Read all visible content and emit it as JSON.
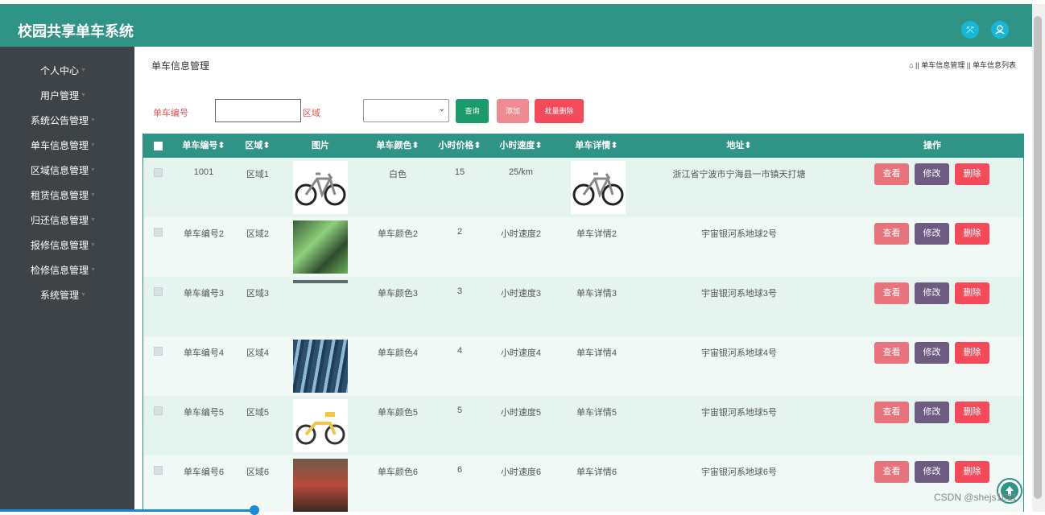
{
  "app": {
    "title": "校园共享单车系统"
  },
  "header": {
    "icons": [
      "expand-icon",
      "user-icon"
    ]
  },
  "sidebar": {
    "items": [
      {
        "label": "个人中心"
      },
      {
        "label": "用户管理"
      },
      {
        "label": "系统公告管理"
      },
      {
        "label": "单车信息管理"
      },
      {
        "label": "区域信息管理"
      },
      {
        "label": "租赁信息管理"
      },
      {
        "label": "归还信息管理"
      },
      {
        "label": "报修信息管理"
      },
      {
        "label": "检修信息管理"
      },
      {
        "label": "系统管理"
      }
    ]
  },
  "main": {
    "title": "单车信息管理",
    "breadcrumb": {
      "sep": "||",
      "item1": "单车信息管理",
      "item2": "单车信息列表"
    }
  },
  "search": {
    "bike_no_label": "单车编号",
    "bike_no_value": "",
    "region_label": "区域",
    "region_value": "",
    "query_btn": "查询",
    "add_btn": "添加",
    "batch_delete_btn": "批量删除"
  },
  "table": {
    "headers": [
      "单车编号",
      "区域",
      "图片",
      "单车颜色",
      "小时价格",
      "小时速度",
      "单车详情",
      "地址",
      "操作"
    ],
    "rows": [
      {
        "bike_no": "1001",
        "region": "区域1",
        "color": "白色",
        "price": "15",
        "speed": "25/km",
        "detail": "",
        "address": "浙江省宁波市宁海县一市镇天打塘"
      },
      {
        "bike_no": "单车编号2",
        "region": "区域2",
        "color": "单车颜色2",
        "price": "2",
        "speed": "小时速度2",
        "detail": "单车详情2",
        "address": "宇宙银河系地球2号"
      },
      {
        "bike_no": "单车编号3",
        "region": "区域3",
        "color": "单车颜色3",
        "price": "3",
        "speed": "小时速度3",
        "detail": "单车详情3",
        "address": "宇宙银河系地球3号"
      },
      {
        "bike_no": "单车编号4",
        "region": "区域4",
        "color": "单车颜色4",
        "price": "4",
        "speed": "小时速度4",
        "detail": "单车详情4",
        "address": "宇宙银河系地球4号"
      },
      {
        "bike_no": "单车编号5",
        "region": "区域5",
        "color": "单车颜色5",
        "price": "5",
        "speed": "小时速度5",
        "detail": "单车详情5",
        "address": "宇宙银河系地球5号"
      },
      {
        "bike_no": "单车编号6",
        "region": "区域6",
        "color": "单车颜色6",
        "price": "6",
        "speed": "小时速度6",
        "detail": "单车详情6",
        "address": "宇宙银河系地球6号"
      }
    ],
    "actions": {
      "view": "查看",
      "edit": "修改",
      "delete": "删除"
    }
  },
  "watermark": "CSDN @shejs1011",
  "colors": {
    "header": "#2f9385",
    "sidebar": "#3d4347",
    "view": "#e8737c",
    "edit": "#6d5b82",
    "delete": "#f44a5a",
    "query": "#1b9a6b",
    "add": "#f08a93",
    "batch": "#f44a5a",
    "row_even": "#e6f4ef",
    "row_odd": "#f0f9f6"
  }
}
